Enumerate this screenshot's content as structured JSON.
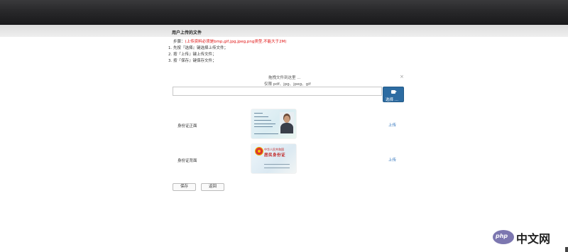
{
  "page": {
    "title": "用户上传的文件"
  },
  "instructions": {
    "steps_label": "步骤：",
    "note": "(上传资料必须是bmp,gif,jpg,jpeg,png类型,不能大于2M)",
    "step1": "1. 先按『选择』键选择上传文件；",
    "step2": "2. 按『上传』键上传文件；",
    "step3": "3. 按『保存』键保存文件；"
  },
  "uploader": {
    "drop_text": "拖拽文件到这里 ...",
    "allowed_text": "仅限 pdf、jpg、jpeg、gif",
    "close": "×",
    "file_value": "",
    "browse_label": "选择 ..."
  },
  "documents": [
    {
      "label": "身份证正面",
      "action": "上传"
    },
    {
      "label": "身份证背面",
      "action": "上传"
    }
  ],
  "id_card_back": {
    "title": "中华人民共和国",
    "subtitle": "居民身份证"
  },
  "actions": {
    "save": "保存",
    "back": "返回"
  },
  "logo": {
    "mark": "php",
    "text": "中文网",
    "color": "#7c77b0"
  },
  "colors": {
    "accent": "#2d6ca2",
    "link": "#2a6fbb",
    "warning": "#e01010"
  }
}
